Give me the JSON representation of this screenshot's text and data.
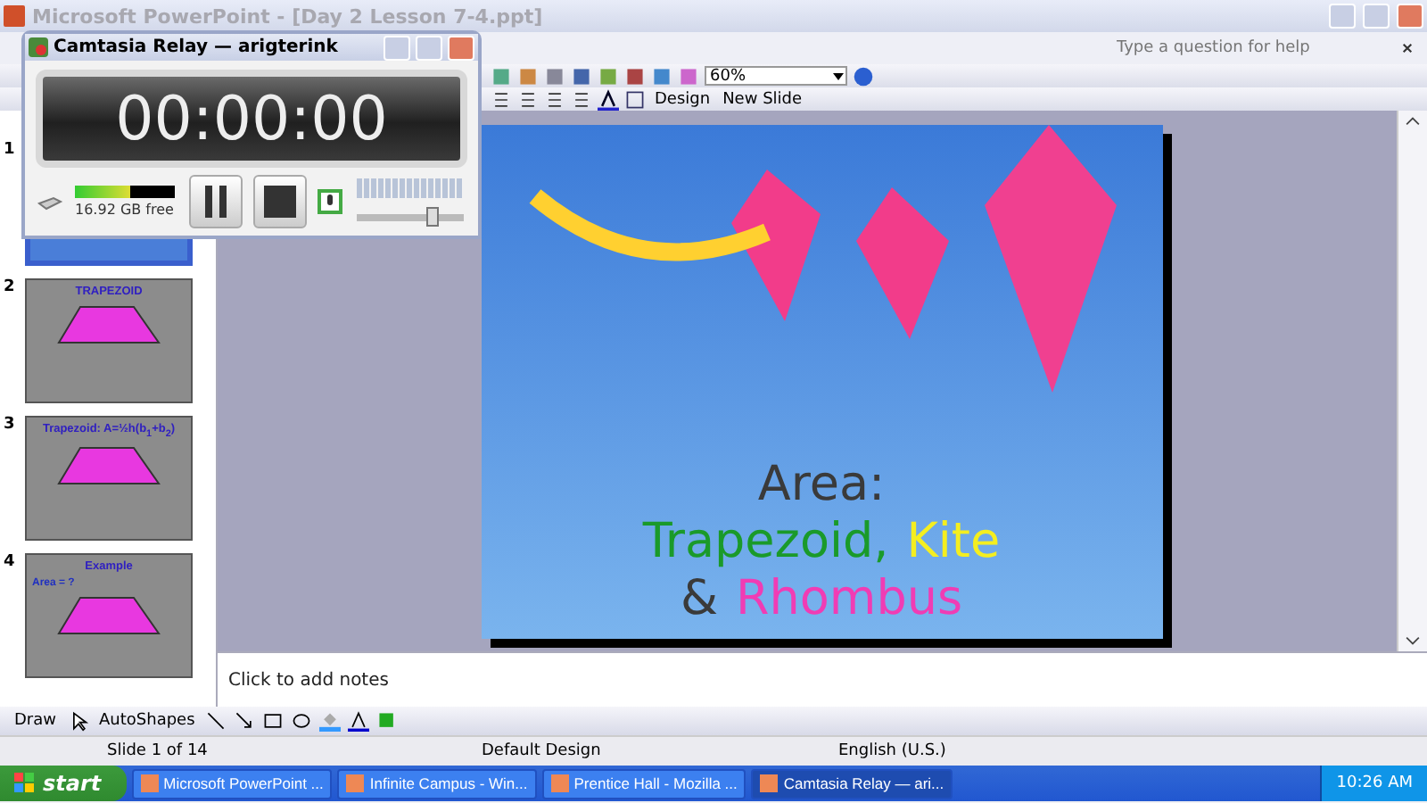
{
  "window": {
    "title": "Microsoft PowerPoint - [Day 2 Lesson  7-4.ppt]"
  },
  "help_search": {
    "placeholder": "Type a question for help"
  },
  "toolbar": {
    "zoom": "60%",
    "buttons": [
      "Design",
      "New Slide"
    ]
  },
  "slides_panel": {
    "items": [
      {
        "number": "1",
        "selected": true
      },
      {
        "number": "2",
        "selected": false,
        "texts": [
          "TRAPEZOID"
        ]
      },
      {
        "number": "3",
        "selected": false,
        "texts": [
          "Trapezoid: A=½h(b$_{1}$+b$_{2}$)"
        ]
      },
      {
        "number": "4",
        "selected": false,
        "texts": [
          "Example",
          "Area = ?"
        ]
      }
    ]
  },
  "slide": {
    "lines": [
      {
        "segments": [
          {
            "text": "Area:",
            "color": "#3a3a3a"
          }
        ]
      },
      {
        "segments": [
          {
            "text": "Trapezoid,",
            "color": "#1a9a2a"
          },
          {
            "text": "Kite",
            "color": "#f4ee20"
          }
        ]
      },
      {
        "segments": [
          {
            "text": "&",
            "color": "#3a3a3a"
          },
          {
            "text": "Rhombus",
            "color": "#f03cb4"
          }
        ]
      }
    ]
  },
  "notes": {
    "placeholder": "Click to add notes"
  },
  "drawing_toolbar": {
    "buttons": [
      "Draw",
      "AutoShapes"
    ]
  },
  "status_bar": [
    "Slide 1 of 14",
    "Default Design",
    "English (U.S.)"
  ],
  "taskbar": {
    "start": "start",
    "tasks": [
      {
        "label": "Microsoft PowerPoint ...",
        "selected": false
      },
      {
        "label": "Infinite Campus - Win...",
        "selected": false
      },
      {
        "label": "Prentice Hall - Mozilla ...",
        "selected": false
      },
      {
        "label": "Camtasia Relay — ari...",
        "selected": true
      }
    ],
    "clock": "10:26 AM"
  },
  "recorder": {
    "title": "Camtasia Relay — arigterink",
    "timer": "00:00:00",
    "disk": {
      "level": 0.55,
      "reading": "16.92 GB free"
    },
    "volume": {
      "level": 0.72
    }
  }
}
